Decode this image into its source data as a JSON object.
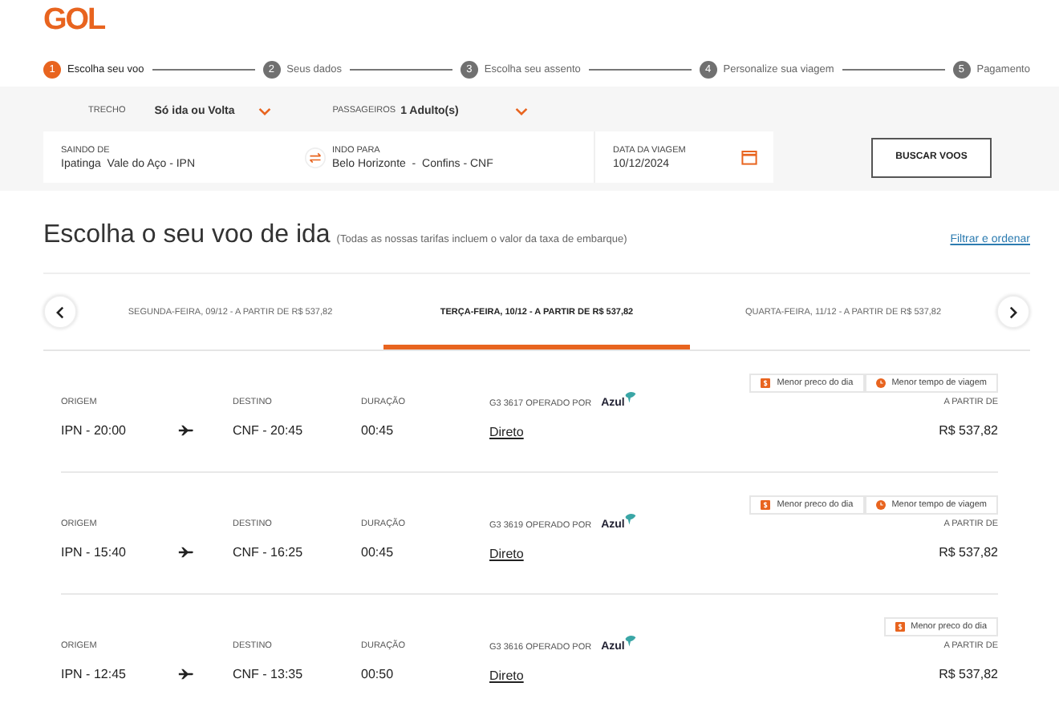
{
  "logo": "GOL",
  "steps": [
    {
      "number": "1",
      "label": "Escolha seu voo",
      "selected": true
    },
    {
      "number": "2",
      "label": "Seus dados",
      "selected": false
    },
    {
      "number": "3",
      "label": "Escolha seu assento",
      "selected": false
    },
    {
      "number": "4",
      "label": "Personalize sua viagem",
      "selected": false
    },
    {
      "number": "5",
      "label": "Pagamento",
      "selected": false
    }
  ],
  "search": {
    "trip_label": "TRECHO",
    "trip_value": "Só ida ou Volta",
    "passengers_label": "PASSAGEIROS",
    "passengers_value": "1 Adulto(s)",
    "origin_label": "SAINDO DE",
    "origin_value": "Ipatinga  Vale do Aço - IPN",
    "destination_label": "INDO PARA",
    "destination_value": "Belo Horizonte  -  Confins - CNF",
    "date_label": "DATA DA VIAGEM",
    "date_value": "10/12/2024",
    "button": "BUSCAR VOOS"
  },
  "heading": {
    "title": "Escolha o seu voo de ida",
    "note": "(Todas as nossas tarifas incluem o valor da taxa de embarque)",
    "filter_link": "Filtrar e ordenar"
  },
  "date_tabs": [
    {
      "label": "SEGUNDA-FEIRA, 09/12 - A PARTIR DE R$ 537,82",
      "selected": false
    },
    {
      "label": "TERÇA-FEIRA, 10/12 - A PARTIR DE R$ 537,82",
      "selected": true
    },
    {
      "label": "QUARTA-FEIRA, 11/12 - A PARTIR DE R$ 537,82",
      "selected": false
    }
  ],
  "flights": [
    {
      "badges": [
        {
          "kind": "price",
          "label": "Menor preco do dia"
        },
        {
          "kind": "time",
          "label": "Menor tempo de viagem"
        }
      ],
      "origin_label": "ORIGEM",
      "origin": "IPN - 20:00",
      "destination_label": "DESTINO",
      "destination": "CNF - 20:45",
      "duration_label": "DURAÇÃO",
      "duration": "00:45",
      "operator_label": "G3 3617 OPERADO POR",
      "operator": "Azul",
      "stops": "Direto",
      "price_label": "A PARTIR DE",
      "price": "R$ 537,82"
    },
    {
      "badges": [
        {
          "kind": "price",
          "label": "Menor preco do dia"
        },
        {
          "kind": "time",
          "label": "Menor tempo de viagem"
        }
      ],
      "origin_label": "ORIGEM",
      "origin": "IPN - 15:40",
      "destination_label": "DESTINO",
      "destination": "CNF - 16:25",
      "duration_label": "DURAÇÃO",
      "duration": "00:45",
      "operator_label": "G3 3619 OPERADO POR",
      "operator": "Azul",
      "stops": "Direto",
      "price_label": "A PARTIR DE",
      "price": "R$ 537,82"
    },
    {
      "badges": [
        {
          "kind": "price",
          "label": "Menor preco do dia"
        }
      ],
      "origin_label": "ORIGEM",
      "origin": "IPN - 12:45",
      "destination_label": "DESTINO",
      "destination": "CNF - 13:35",
      "duration_label": "DURAÇÃO",
      "duration": "00:50",
      "operator_label": "G3 3616 OPERADO POR",
      "operator": "Azul",
      "stops": "Direto",
      "price_label": "A PARTIR DE",
      "price": "R$ 537,82"
    }
  ]
}
